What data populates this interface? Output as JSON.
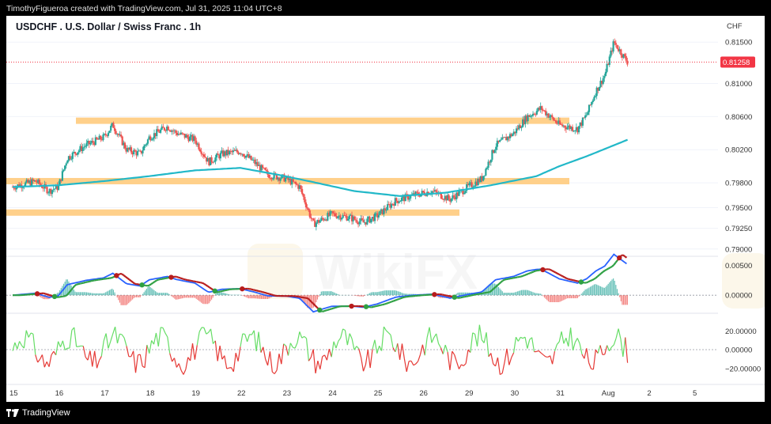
{
  "header": {
    "credit": "TimothyFigueroa created with TradingView.com, Jul 31, 2025 11:04 UTC+8"
  },
  "footer": {
    "brand": "TradingView"
  },
  "colors": {
    "candle_up": "#26a69a",
    "candle_down": "#ef5350",
    "ma": "#22b8c8",
    "zone": "#ffd08a",
    "price_tag": "#f23645",
    "macd_line": "#2962ff",
    "signal_line_up": "#2ea043",
    "signal_line_down": "#b71c1c",
    "osc_up": "#66dd66",
    "osc_down": "#e53935"
  },
  "chart_data": {
    "type": "candlestick",
    "title": "USDCHF . U.S. Dollar / Swiss Franc . 1h",
    "currency": "CHF",
    "last_price": "0.81258",
    "price_axis": {
      "ticks": [
        "0.81500",
        "0.81000",
        "0.80600",
        "0.80200",
        "0.79800",
        "0.79500",
        "0.79250",
        "0.79000"
      ],
      "range": [
        0.7895,
        0.8155
      ]
    },
    "x_axis": {
      "ticks": [
        "15",
        "16",
        "17",
        "18",
        "19",
        "22",
        "23",
        "24",
        "25",
        "26",
        "29",
        "30",
        "31",
        "Aug",
        "2",
        "5"
      ]
    },
    "horizontal_zones": [
      0.8055,
      0.7982,
      0.7944
    ],
    "close_path": [
      [
        0,
        0.7975
      ],
      [
        0.5,
        0.7982
      ],
      [
        0.8,
        0.797
      ],
      [
        1.0,
        0.7975
      ],
      [
        1.2,
        0.801
      ],
      [
        1.6,
        0.8025
      ],
      [
        2.0,
        0.8035
      ],
      [
        2.2,
        0.805
      ],
      [
        2.5,
        0.802
      ],
      [
        2.8,
        0.8015
      ],
      [
        3.0,
        0.8035
      ],
      [
        3.4,
        0.8048
      ],
      [
        3.6,
        0.804
      ],
      [
        4.0,
        0.8032
      ],
      [
        4.3,
        0.8005
      ],
      [
        4.6,
        0.8015
      ],
      [
        5.0,
        0.8018
      ],
      [
        5.3,
        0.8005
      ],
      [
        5.6,
        0.799
      ],
      [
        6.0,
        0.7985
      ],
      [
        6.3,
        0.7975
      ],
      [
        6.6,
        0.793
      ],
      [
        7.0,
        0.7942
      ],
      [
        7.4,
        0.7938
      ],
      [
        7.7,
        0.7932
      ],
      [
        8.0,
        0.794
      ],
      [
        8.4,
        0.7958
      ],
      [
        8.8,
        0.7965
      ],
      [
        9.2,
        0.797
      ],
      [
        9.6,
        0.796
      ],
      [
        10.0,
        0.7975
      ],
      [
        10.3,
        0.7985
      ],
      [
        10.6,
        0.8025
      ],
      [
        11.0,
        0.804
      ],
      [
        11.3,
        0.806
      ],
      [
        11.6,
        0.807
      ],
      [
        12.0,
        0.805
      ],
      [
        12.4,
        0.8045
      ],
      [
        12.6,
        0.8062
      ],
      [
        12.8,
        0.809
      ],
      [
        13.0,
        0.811
      ],
      [
        13.2,
        0.815
      ],
      [
        13.5,
        0.8126
      ]
    ],
    "moving_average_path": [
      [
        0,
        0.7975
      ],
      [
        1.0,
        0.7977
      ],
      [
        2.0,
        0.7982
      ],
      [
        3.0,
        0.7988
      ],
      [
        4.0,
        0.7995
      ],
      [
        5.0,
        0.7998
      ],
      [
        5.8,
        0.799
      ],
      [
        6.5,
        0.7982
      ],
      [
        7.5,
        0.797
      ],
      [
        8.5,
        0.7964
      ],
      [
        9.5,
        0.7968
      ],
      [
        10.5,
        0.7977
      ],
      [
        11.5,
        0.7988
      ],
      [
        12.0,
        0.8
      ],
      [
        12.6,
        0.8012
      ],
      [
        13.5,
        0.8032
      ]
    ],
    "macd": {
      "ticks": [
        "0.00500",
        "0.00000"
      ],
      "range": [
        -0.0025,
        0.006
      ]
    },
    "oscillator": {
      "ticks": [
        "20.00000",
        "0.00000",
        "−20.00000"
      ],
      "range": [
        -32,
        32
      ]
    }
  }
}
